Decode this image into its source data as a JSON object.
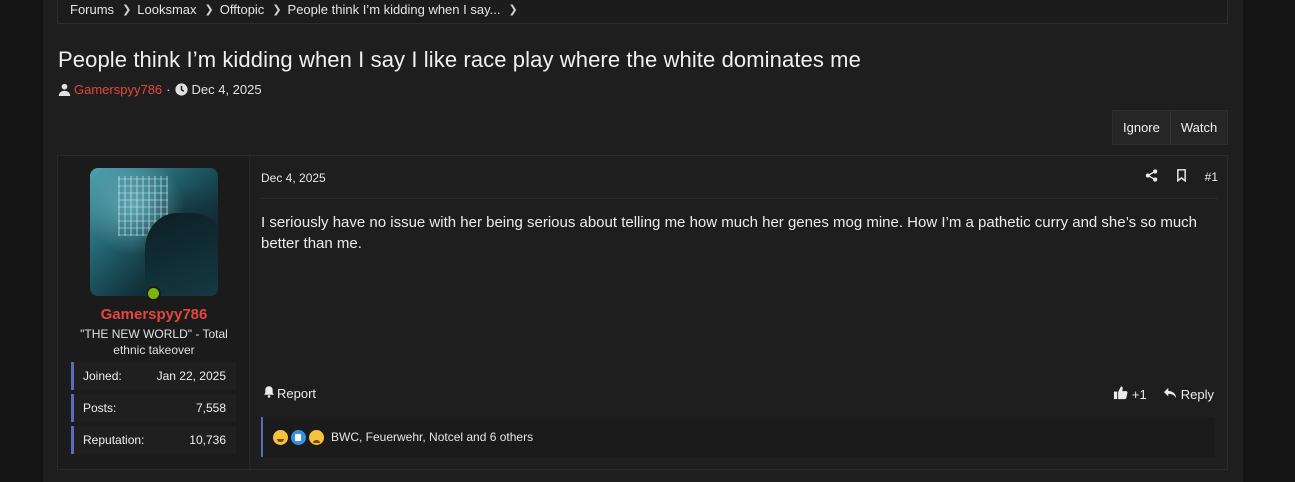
{
  "breadcrumb": [
    "Forums",
    "Looksmax",
    "Offtopic",
    "People think I’m kidding when I say..."
  ],
  "thread": {
    "title": "People think I’m kidding when I say I like race play where the white dominates me",
    "author": "Gamerspyy786",
    "date": "Dec 4, 2025",
    "separator": "·"
  },
  "buttons": {
    "ignore": "Ignore",
    "watch": "Watch"
  },
  "post": {
    "user": {
      "name": "Gamerspyy786",
      "title": "\"THE NEW WORLD\" - Total ethnic takeover",
      "stats": [
        {
          "label": "Joined:",
          "value": "Jan 22, 2025"
        },
        {
          "label": "Posts:",
          "value": "7,558"
        },
        {
          "label": "Reputation:",
          "value": "10,736"
        }
      ]
    },
    "date": "Dec 4, 2025",
    "number": "#1",
    "body": "I seriously have no issue with her being serious about telling me how much her genes mog mine. How I’m a pathetic curry and she’s so much better than me.",
    "report_label": "Report",
    "like_count": "+1",
    "reply_label": "Reply",
    "reactions_text": "BWC, Feuerwehr, Notcel and 6 others"
  },
  "colors": {
    "accent_red": "#e2483f",
    "online_green": "#7bb40a",
    "stat_border": "#5a6bb8"
  },
  "icons": [
    "user-icon",
    "clock-icon",
    "share-icon",
    "bookmark-icon",
    "bell-icon",
    "thumbs-up-icon",
    "reply-icon",
    "chevron-right-icon"
  ]
}
